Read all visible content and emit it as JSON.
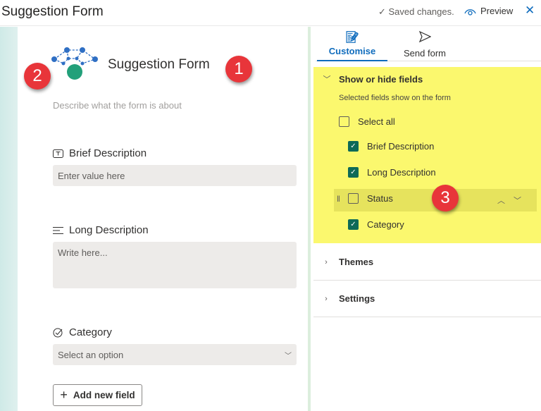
{
  "header": {
    "title": "Suggestion Form",
    "saved": "✓ Saved changes.",
    "preview": "Preview",
    "close": "✕"
  },
  "form": {
    "title": "Suggestion Form",
    "description": "Describe what the form is about",
    "fields": [
      {
        "label": "Brief Description",
        "placeholder": "Enter value here"
      },
      {
        "label": "Long Description",
        "placeholder": "Write here..."
      },
      {
        "label": "Category",
        "placeholder": "Select an option"
      }
    ],
    "add_field": "Add new field"
  },
  "badges": [
    "1",
    "2",
    "3"
  ],
  "panel": {
    "tabs": [
      {
        "label": "Customise",
        "active": true
      },
      {
        "label": "Send form"
      }
    ],
    "show_hide": {
      "title": "Show or hide fields",
      "subtitle": "Selected fields show on the form",
      "select_all": "Select all",
      "items": [
        {
          "label": "Brief Description",
          "checked": true
        },
        {
          "label": "Long Description",
          "checked": true
        },
        {
          "label": "Status",
          "checked": false
        },
        {
          "label": "Category",
          "checked": true
        }
      ]
    },
    "themes": "Themes",
    "settings": "Settings"
  },
  "colors": {
    "accent": "#0f6cbd",
    "checkbox": "#0e6a57",
    "highlight": "#fbf86e",
    "badge": "#e8353a"
  }
}
